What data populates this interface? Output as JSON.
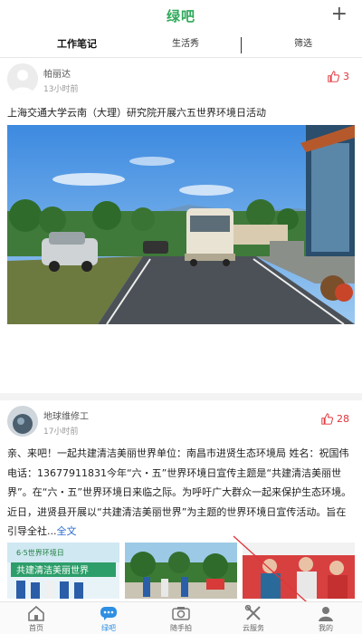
{
  "header": {
    "title": "绿吧",
    "add_label": "+"
  },
  "tabs": [
    {
      "label": "工作笔记",
      "active": true
    },
    {
      "label": "生活秀",
      "active": false
    },
    {
      "label": "筛选",
      "active": false
    }
  ],
  "posts": [
    {
      "username": "帕丽达",
      "time": "13小时前",
      "likes": "3",
      "text": "上海交通大学云南（大理）研究院开展六五世界环境日活动"
    },
    {
      "username": "地球维修工",
      "time": "17小时前",
      "likes": "28",
      "text": "亲、来吧！一起共建清洁美丽世界单位：南昌市进贤生态环境局 姓名：祝国伟 电话：13677911831今年“六・五”世界环境日宣传主题是“共建清洁美丽世界”。在“六・五”世界环境日来临之际。为呼吁广大群众一起来保护生态环境。近日，进贤县开展以“共建清洁美丽世界”为主题的世界环境日宣传活动。旨在引导全社...",
      "more_label": "全文",
      "thumb1_banner": "共建清洁美丽世界",
      "thumb1_title": "6·5世界环境日"
    }
  ],
  "bottom_nav": [
    {
      "label": "首页",
      "icon": "home-icon",
      "active": false
    },
    {
      "label": "绿吧",
      "icon": "chat-bubble-icon",
      "active": true
    },
    {
      "label": "随手拍",
      "icon": "camera-icon",
      "active": false
    },
    {
      "label": "云服务",
      "icon": "tools-icon",
      "active": false
    },
    {
      "label": "我的",
      "icon": "user-icon",
      "active": false
    }
  ],
  "colors": {
    "brand": "#2fa85a",
    "like": "#e0343a",
    "link": "#2a6bd1",
    "nav_active": "#2e8fe3"
  }
}
